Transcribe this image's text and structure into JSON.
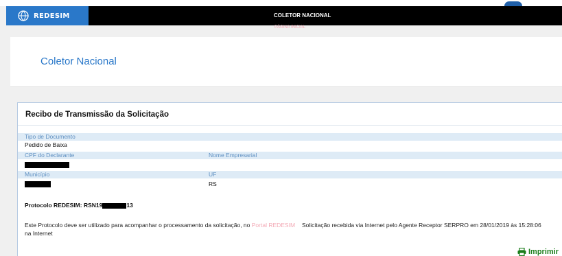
{
  "header": {
    "logo_text": "REDESIM",
    "title": "COLETOR NACIONAL",
    "subnav": "PÁGINA INICIAL"
  },
  "banner": {
    "title": "Coletor Nacional"
  },
  "receipt": {
    "heading": "Recibo de Transmissão da Solicitação",
    "labels": {
      "tipo": "Tipo de Documento",
      "cpf": "CPF do Declarante",
      "nome": "Nome Empresarial",
      "municipio": "Município",
      "uf": "UF"
    },
    "values": {
      "tipo": "Pedido de Baixa",
      "uf": "RS"
    },
    "protocolo_prefix": "Protocolo REDESIM: RSN19",
    "protocolo_suffix": "13",
    "note_text": "Este Protocolo deve ser utilizado para acompanhar o processamento da solicitação, no ",
    "note_link": "Portal REDESIM",
    "note_tail": " na Internet",
    "received": "Solicitação recebida via Internet pelo Agente Receptor SERPRO em 28/01/2019 às 15:28:06",
    "print_label": "Imprimir"
  },
  "colors": {
    "header_bg": "#000000",
    "logo_bg": "#2a78c9",
    "accent": "#2a78c9",
    "print": "#1a7d1a",
    "link": "#f3a9b5"
  }
}
